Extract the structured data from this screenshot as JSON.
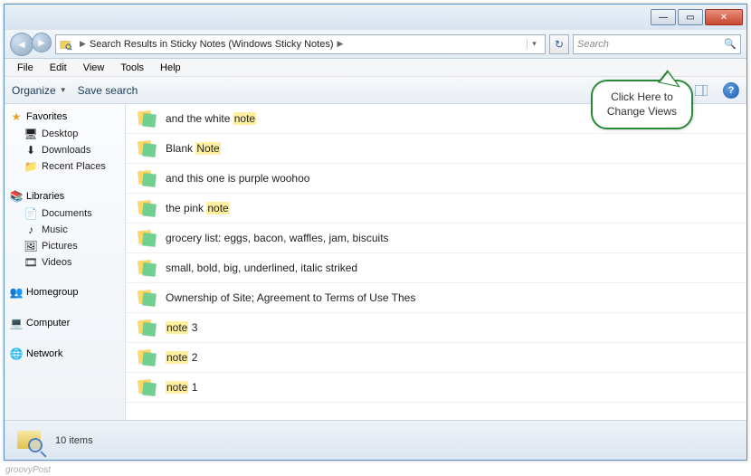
{
  "titlebar": {
    "min": "—",
    "max": "▭",
    "close": "✕"
  },
  "address": {
    "path_label": "Search Results in Sticky Notes (Windows Sticky Notes)",
    "sep": "▶"
  },
  "search": {
    "placeholder": "Search"
  },
  "menubar": [
    "File",
    "Edit",
    "View",
    "Tools",
    "Help"
  ],
  "toolbar": {
    "organize": "Organize",
    "save_search": "Save search"
  },
  "sidebar": {
    "favorites": {
      "label": "Favorites",
      "items": [
        "Desktop",
        "Downloads",
        "Recent Places"
      ]
    },
    "libraries": {
      "label": "Libraries",
      "items": [
        "Documents",
        "Music",
        "Pictures",
        "Videos"
      ]
    },
    "homegroup": {
      "label": "Homegroup"
    },
    "computer": {
      "label": "Computer"
    },
    "network": {
      "label": "Network"
    }
  },
  "results": [
    {
      "text": "and the white ",
      "hl": "note",
      "after": ""
    },
    {
      "text": "Blank ",
      "hl": "Note",
      "after": ""
    },
    {
      "text": "and this one is purple woohoo",
      "hl": "",
      "after": ""
    },
    {
      "text": "the pink ",
      "hl": "note",
      "after": ""
    },
    {
      "text": "grocery list: eggs, bacon, waffles, jam, biscuits",
      "hl": "",
      "after": ""
    },
    {
      "text": "small, bold,  big,  underlined, italic striked",
      "hl": "",
      "after": ""
    },
    {
      "text": "Ownership of Site; Agreement to Terms of Use Thes",
      "hl": "",
      "after": ""
    },
    {
      "text": "",
      "hl": "note",
      "after": " 3"
    },
    {
      "text": "",
      "hl": "note",
      "after": " 2"
    },
    {
      "text": "",
      "hl": "note",
      "after": " 1"
    }
  ],
  "callout": {
    "line1": "Click Here to",
    "line2": "Change Views"
  },
  "status": {
    "count_label": "10 items"
  },
  "watermark": "groovyPost"
}
